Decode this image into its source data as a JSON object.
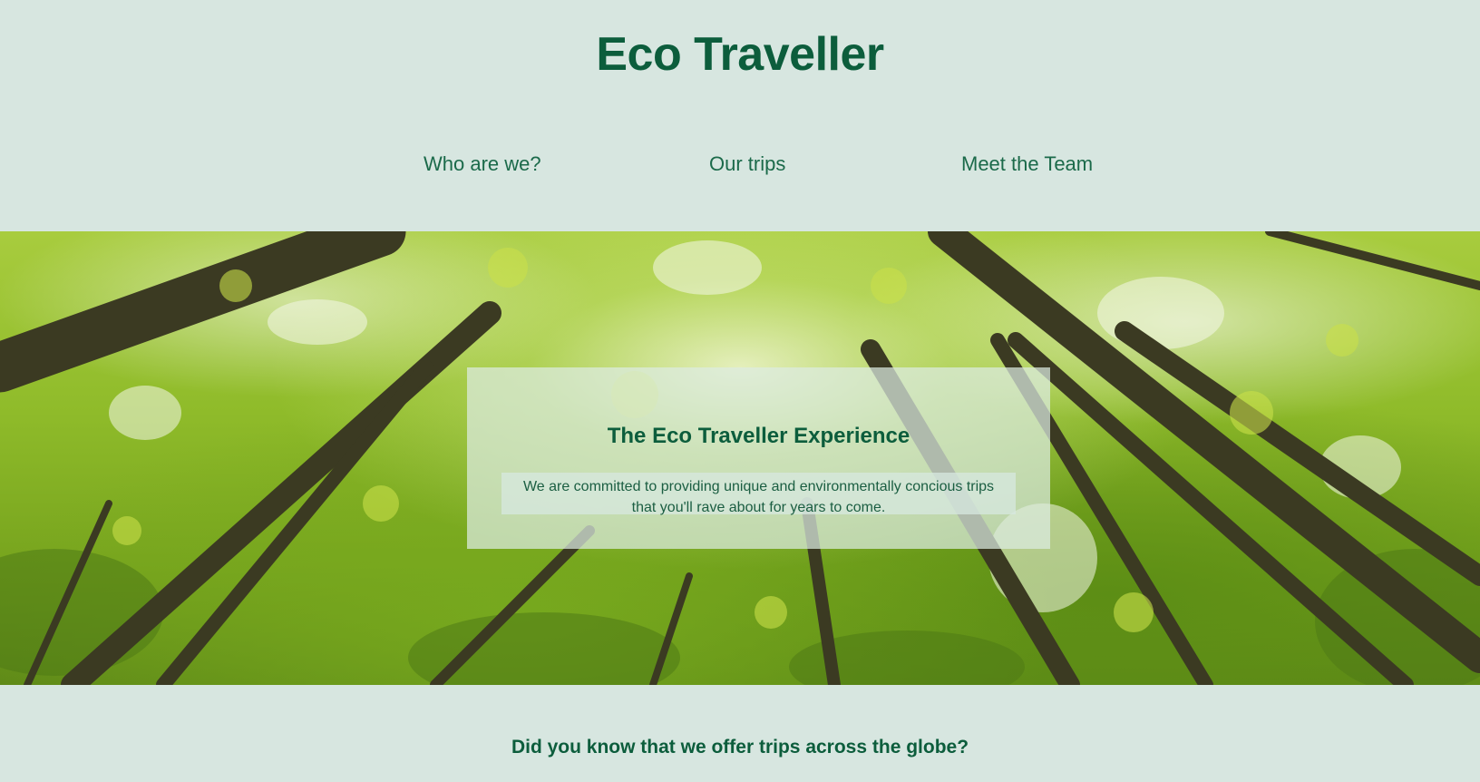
{
  "header": {
    "title": "Eco Traveller"
  },
  "nav": {
    "items": [
      {
        "label": "Who are we?"
      },
      {
        "label": "Our trips"
      },
      {
        "label": "Meet the Team"
      }
    ]
  },
  "hero": {
    "heading": "The Eco Traveller Experience",
    "text_line1": "We are committed to providing unique and environmentally concious trips",
    "text_line2": "that you'll rave about for years to come."
  },
  "section": {
    "question": "Did you know that we offer trips across the globe?"
  },
  "colors": {
    "background": "#d7e6e0",
    "brand_green": "#0c5d3c"
  }
}
